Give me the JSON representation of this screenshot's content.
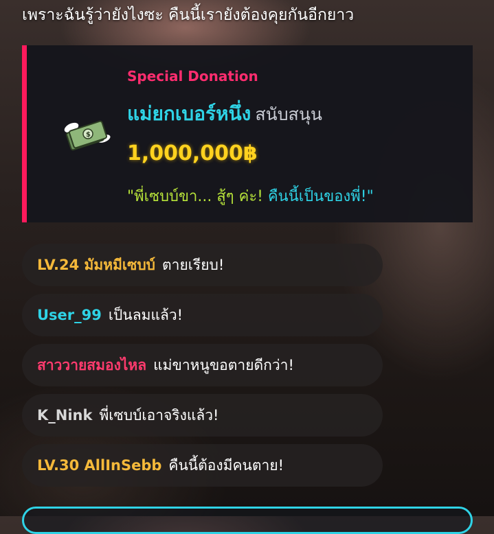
{
  "caption": "เพราะฉันรู้ว่ายังไงซะ คืนนี้เรายังต้องคุยกันอีกยาว",
  "donation": {
    "label": "Special Donation",
    "donor": "แม่ยกเบอร์หนึ่ง",
    "action": "สนับสนุน",
    "amount": "1,000,000฿",
    "message_part1": "\"พี่เซบบ์ขา... สู้ๆ ค่ะ! ",
    "message_part2": "คืนนี้เป็นของพี่!\"",
    "icon": "flying-money-icon"
  },
  "chat": [
    {
      "user": "LV.24 มัมหมีเซบบ์",
      "text": "ตายเรียบ!",
      "color": "#f5b93a"
    },
    {
      "user": "User_99",
      "text": "เป็นลมแล้ว!",
      "color": "#2fd3e6"
    },
    {
      "user": "สาววายสมองไหล",
      "text": "แม่ขาหนูขอตายดีกว่า!",
      "color": "#ff3b6e"
    },
    {
      "user": "K_Nink",
      "text": "พี่เซบบ์เอาจริงแล้ว!",
      "color": "#d8d8d8"
    },
    {
      "user": "LV.30 AllInSebb",
      "text": "คืนนี้ต้องมีคนตาย!",
      "color": "#f5b93a"
    }
  ],
  "colors": {
    "accent_pink": "#ff1a5c",
    "accent_cyan": "#2fd3e6",
    "amount_gold": "#ffd21f"
  }
}
